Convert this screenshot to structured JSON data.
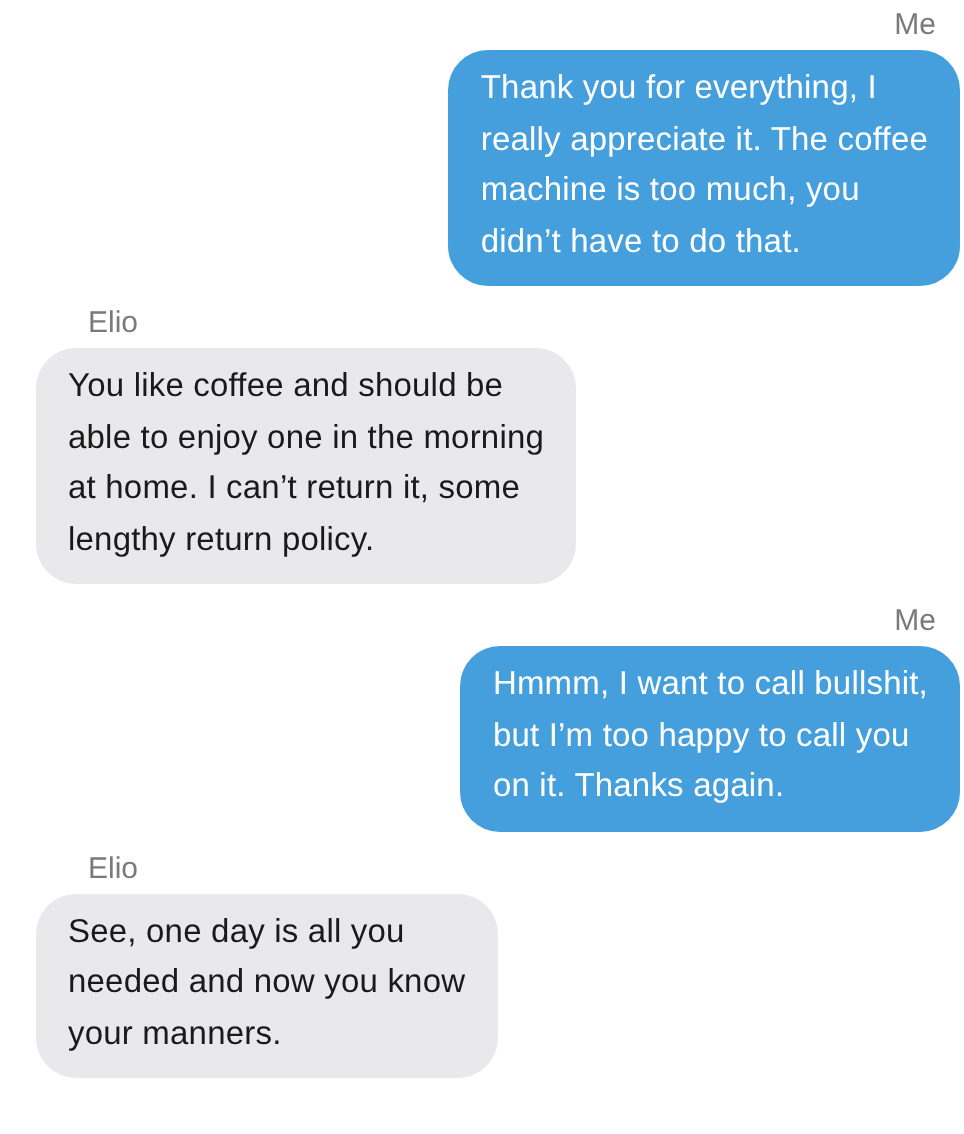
{
  "messages": [
    {
      "sender": "Me",
      "outgoing": true,
      "text": "Thank you for everything, I\nreally appreciate it. The coffee\nmachine is too much, you\ndidn’t have to do that."
    },
    {
      "sender": "Elio",
      "outgoing": false,
      "text": "You like coffee and should be\nable to enjoy one in the morning\nat home. I can’t return it, some\nlengthy return policy."
    },
    {
      "sender": "Me",
      "outgoing": true,
      "text": "Hmmm, I want to call bullshit,\nbut I’m too happy to call you\non it. Thanks again."
    },
    {
      "sender": "Elio",
      "outgoing": false,
      "text": "See, one day is all you\nneeded and now you know\nyour manners."
    }
  ]
}
